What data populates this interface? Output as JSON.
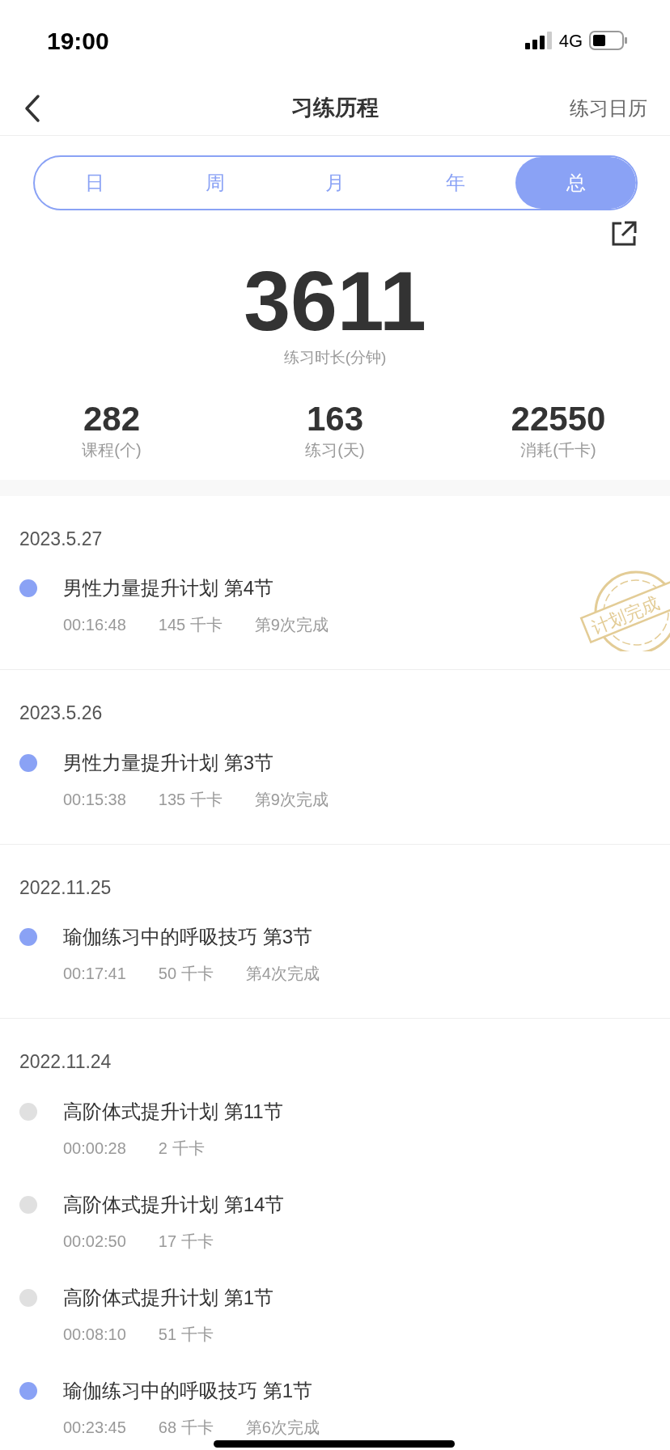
{
  "status_bar": {
    "time": "19:00",
    "network": "4G"
  },
  "nav": {
    "title": "习练历程",
    "action": "练习日历"
  },
  "tabs": [
    {
      "label": "日",
      "selected": false
    },
    {
      "label": "周",
      "selected": false
    },
    {
      "label": "月",
      "selected": false
    },
    {
      "label": "年",
      "selected": false
    },
    {
      "label": "总",
      "selected": true
    }
  ],
  "summary": {
    "value": "3611",
    "label": "练习时长(分钟)"
  },
  "stats": [
    {
      "value": "282",
      "label": "课程(个)"
    },
    {
      "value": "163",
      "label": "练习(天)"
    },
    {
      "value": "22550",
      "label": "消耗(千卡)"
    }
  ],
  "history": [
    {
      "date": "2023.5.27",
      "records": [
        {
          "title": "男性力量提升计划 第4节",
          "color": "#8aa2f5",
          "duration": "00:16:48",
          "calories": "145 千卡",
          "completion": "第9次完成",
          "stamp": "计划完成"
        }
      ]
    },
    {
      "date": "2023.5.26",
      "records": [
        {
          "title": "男性力量提升计划 第3节",
          "color": "#8aa2f5",
          "duration": "00:15:38",
          "calories": "135 千卡",
          "completion": "第9次完成"
        }
      ]
    },
    {
      "date": "2022.11.25",
      "records": [
        {
          "title": "瑜伽练习中的呼吸技巧 第3节",
          "color": "#8aa2f5",
          "duration": "00:17:41",
          "calories": "50 千卡",
          "completion": "第4次完成"
        }
      ]
    },
    {
      "date": "2022.11.24",
      "records": [
        {
          "title": "高阶体式提升计划 第11节",
          "color": "#e0e0e0",
          "duration": "00:00:28",
          "calories": "2 千卡"
        },
        {
          "title": "高阶体式提升计划 第14节",
          "color": "#e0e0e0",
          "duration": "00:02:50",
          "calories": "17 千卡"
        },
        {
          "title": "高阶体式提升计划 第1节",
          "color": "#e0e0e0",
          "duration": "00:08:10",
          "calories": "51 千卡"
        },
        {
          "title": "瑜伽练习中的呼吸技巧 第1节",
          "color": "#8aa2f5",
          "duration": "00:23:45",
          "calories": "68 千卡",
          "completion": "第6次完成"
        }
      ]
    }
  ]
}
